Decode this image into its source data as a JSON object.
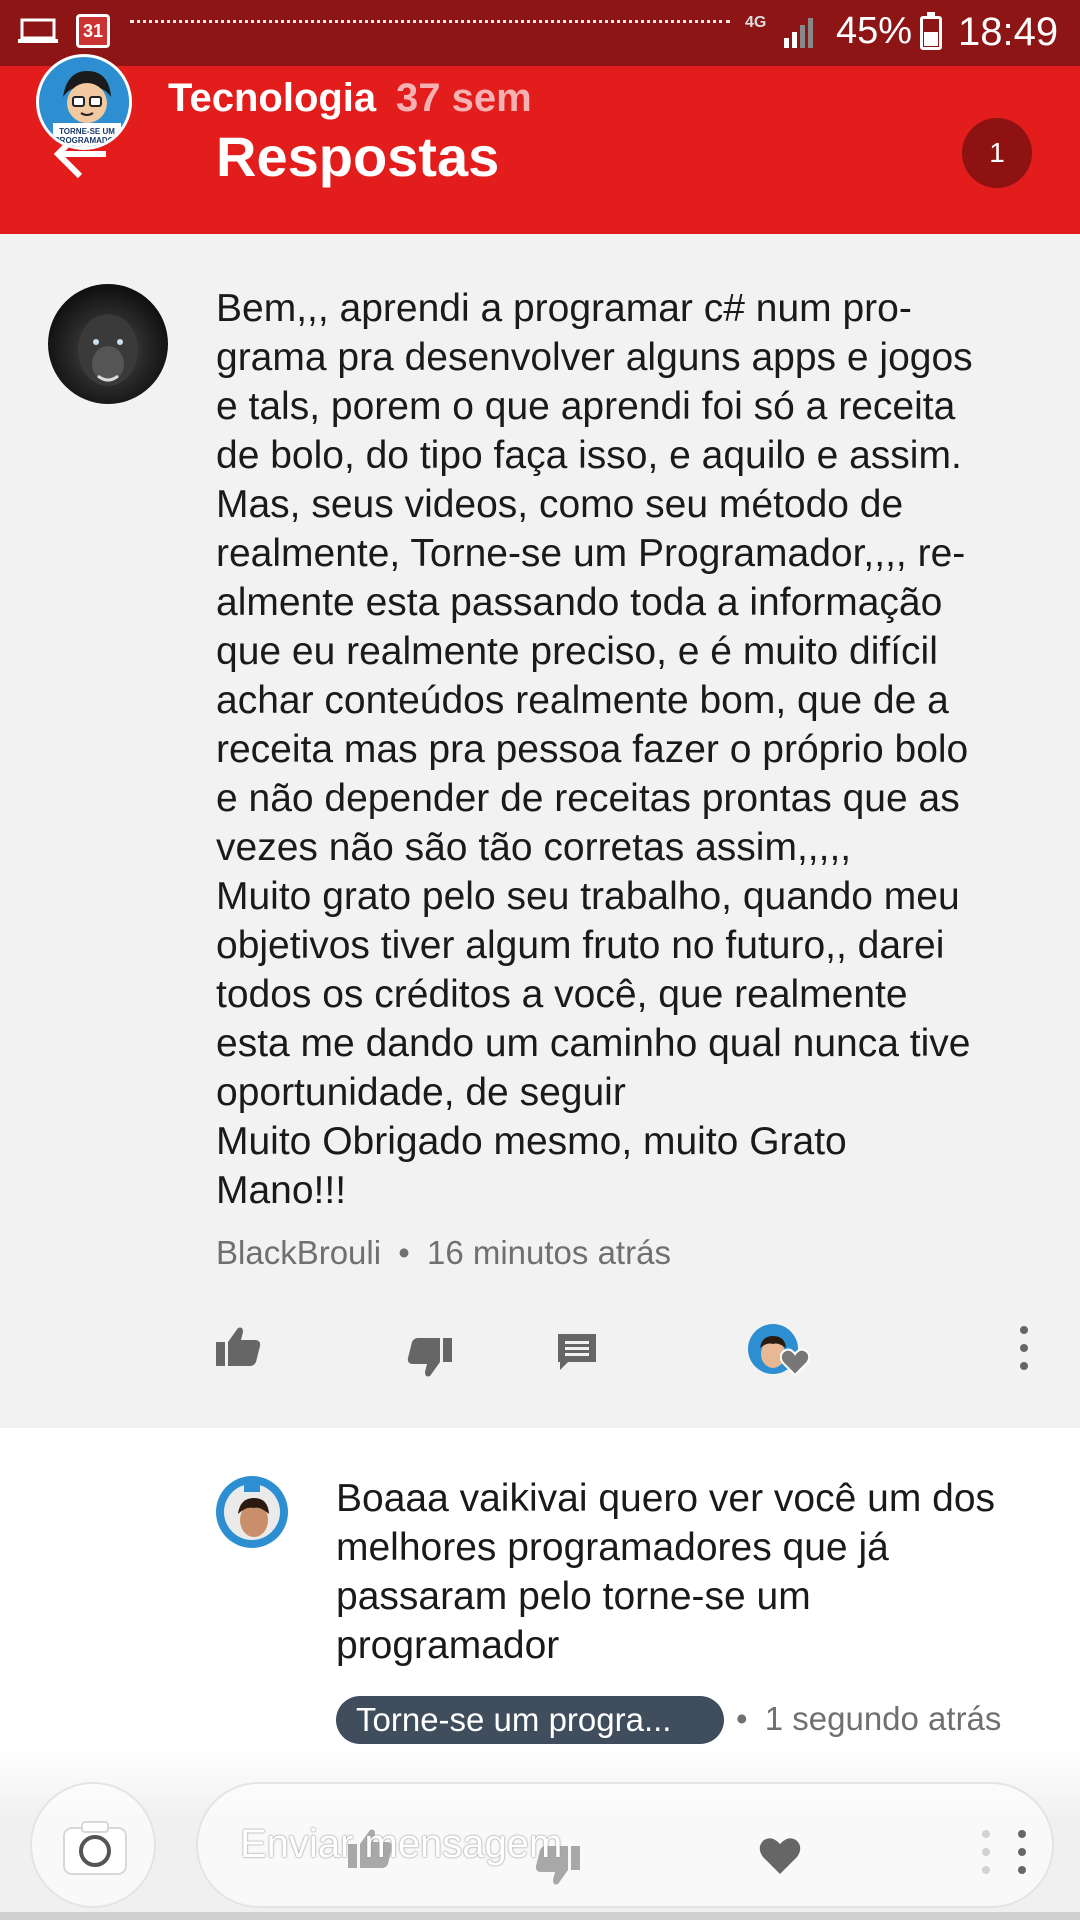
{
  "status_bar": {
    "calendar_date": "31",
    "network": "4G",
    "battery": "45%",
    "time": "18:49"
  },
  "header": {
    "channel_name": "Tecnologia",
    "channel_age": "37 sem",
    "title": "Respostas",
    "reply_count": "1",
    "avatar_text": "TORNE-SE UM PROGRAMADOR"
  },
  "comment": {
    "text": "Bem,,, aprendi a programar c# num pro-\ngrama pra desenvolver alguns apps e jogos\ne tals, porem o que aprendi foi só a receita\nde bolo, do tipo faça isso, e aquilo e assim.\nMas, seus videos, como seu método de\nrealmente, Torne-se um Programador,,,, re-\nalmente esta passando toda a informação\nque eu realmente preciso, e é muito difícil\nachar conteúdos realmente bom, que de a\nreceita mas pra pessoa fazer o próprio bolo\ne não depender de receitas prontas que as\nvezes não são tão corretas assim,,,,,\nMuito grato pelo seu trabalho,  quando meu\nobjetivos tiver algum fruto no futuro,, darei\ntodos os créditos a você, que realmente\nesta me dando um caminho qual nunca tive\noportunidade, de seguir\nMuito Obrigado mesmo, muito Grato\nMano!!!",
    "author": "BlackBrouli",
    "separator": "•",
    "time": "16 minutos atrás"
  },
  "reply": {
    "text": "Boaaa vaikivai quero ver você um dos melhores programadores que já passaram pelo torne-se um programador",
    "author_chip": "Torne-se um progra...",
    "separator": "•",
    "time": "1 segundo atrás"
  },
  "composer": {
    "placeholder": "Enviar mensagem"
  },
  "colors": {
    "status_bar": "#8e1515",
    "header": "#e31c1c",
    "badge": "#8e1212",
    "author_chip": "#3f4d5c",
    "meta_text": "#707070"
  },
  "icons": {
    "back": "arrow-left-icon",
    "like": "thumb-up-icon",
    "dislike": "thumb-down-icon",
    "reply": "comment-icon",
    "heart": "heart-icon",
    "more": "more-vertical-icon",
    "camera": "camera-icon"
  }
}
